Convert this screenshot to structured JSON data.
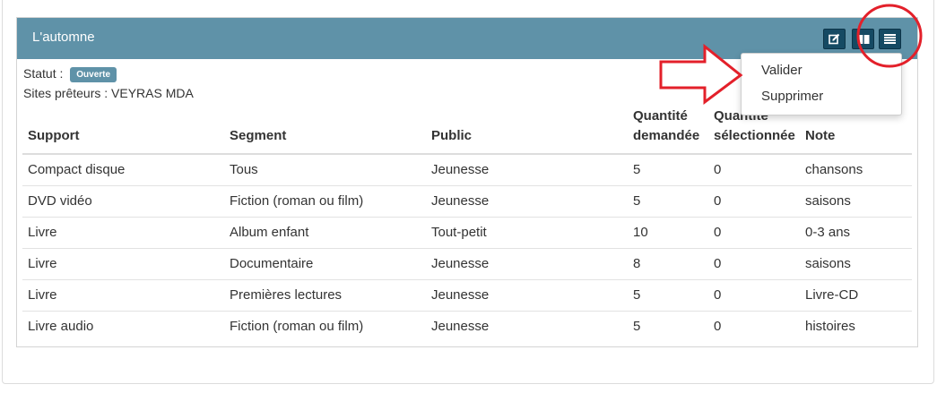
{
  "panel": {
    "title": "L'automne",
    "status_label": "Statut :",
    "status_badge": "Ouverte",
    "sites_text": "Sites prêteurs : VEYRAS MDA",
    "header_buttons": [
      {
        "icon": "edit-icon"
      },
      {
        "icon": "book-icon"
      },
      {
        "icon": "menu-icon"
      }
    ]
  },
  "table": {
    "headers": {
      "support": "Support",
      "segment": "Segment",
      "public": "Public",
      "qty_requested_1": "Quantité",
      "qty_requested_2": "demandée",
      "qty_selected_1": "Quantité",
      "qty_selected_2": "sélectionnée",
      "note": "Note"
    },
    "rows": [
      {
        "support": "Compact disque",
        "segment": "Tous",
        "public": "Jeunesse",
        "qty_requested": "5",
        "qty_selected": "0",
        "note": "chansons"
      },
      {
        "support": "DVD vidéo",
        "segment": "Fiction (roman ou film)",
        "public": "Jeunesse",
        "qty_requested": "5",
        "qty_selected": "0",
        "note": "saisons"
      },
      {
        "support": "Livre",
        "segment": "Album enfant",
        "public": "Tout-petit",
        "qty_requested": "10",
        "qty_selected": "0",
        "note": "0-3 ans"
      },
      {
        "support": "Livre",
        "segment": "Documentaire",
        "public": "Jeunesse",
        "qty_requested": "8",
        "qty_selected": "0",
        "note": "saisons"
      },
      {
        "support": "Livre",
        "segment": "Premières lectures",
        "public": "Jeunesse",
        "qty_requested": "5",
        "qty_selected": "0",
        "note": "Livre-CD"
      },
      {
        "support": "Livre audio",
        "segment": "Fiction (roman ou film)",
        "public": "Jeunesse",
        "qty_requested": "5",
        "qty_selected": "0",
        "note": "histoires"
      }
    ]
  },
  "dropdown": {
    "items": [
      "Valider",
      "Supprimer"
    ]
  },
  "colors": {
    "header_bg": "#5f92a8",
    "button_bg": "#154a63",
    "annotation_red": "#e3202a"
  }
}
